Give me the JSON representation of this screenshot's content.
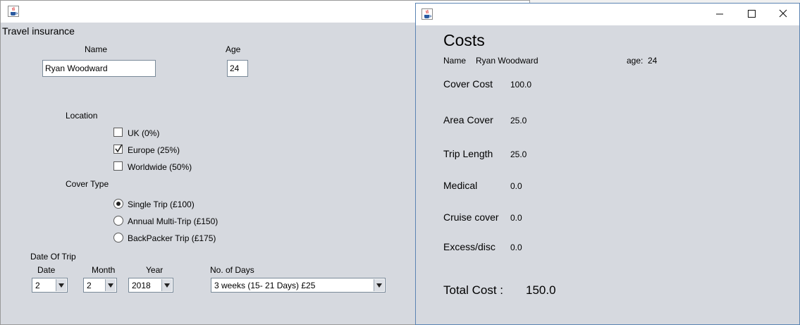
{
  "left_window": {
    "heading": "Travel insurance",
    "name_label": "Name",
    "name_value": "Ryan Woodward",
    "age_label": "Age",
    "age_value": "24",
    "location_label": "Location",
    "locations": [
      {
        "label": "UK (0%)",
        "checked": false
      },
      {
        "label": "Europe (25%)",
        "checked": true
      },
      {
        "label": "Worldwide (50%)",
        "checked": false
      }
    ],
    "cover_type_label": "Cover Type",
    "cover_types": [
      {
        "label": "Single Trip (£100)",
        "selected": true
      },
      {
        "label": "Annual Multi-Trip (£150)",
        "selected": false
      },
      {
        "label": "BackPacker Trip (£175)",
        "selected": false
      }
    ],
    "date_of_trip_label": "Date Of Trip",
    "date_label": "Date",
    "month_label": "Month",
    "year_label": "Year",
    "days_label": "No. of Days",
    "date_value": "2",
    "month_value": "2",
    "year_value": "2018",
    "days_value": "3 weeks (15- 21 Days) £25"
  },
  "right_window": {
    "title": "Costs",
    "name_label": "Name",
    "name_value": "Ryan Woodward",
    "age_label": "age:",
    "age_value": "24",
    "rows": [
      {
        "label": "Cover Cost",
        "value": "100.0"
      },
      {
        "label": "Area Cover",
        "value": "25.0"
      },
      {
        "label": "Trip Length",
        "value": "25.0"
      },
      {
        "label": "Medical",
        "value": "0.0"
      },
      {
        "label": "Cruise cover",
        "value": "0.0"
      },
      {
        "label": "Excess/disc",
        "value": "0.0"
      }
    ],
    "total_label": "Total Cost :",
    "total_value": "150.0"
  },
  "icons": {
    "app_icon": "java-cup-icon",
    "minimize": "minimize-icon",
    "maximize": "maximize-icon",
    "close": "close-icon"
  },
  "colors": {
    "panel_bg": "#d6d9df",
    "titlebar_bg": "#ffffff",
    "active_border": "#5b84b3"
  }
}
